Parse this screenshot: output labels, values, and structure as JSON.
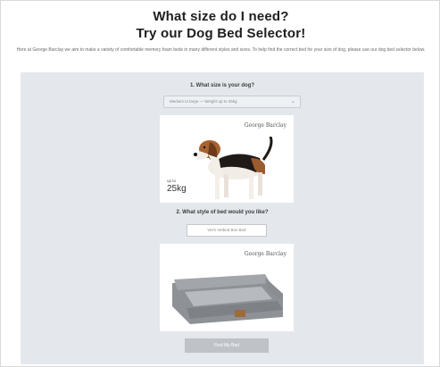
{
  "header": {
    "title_line1": "What size do I need?",
    "title_line2": "Try our Dog Bed Selector!",
    "intro": "Here at George Barclay we aim to make a variety of comfortable memory foam beds in many different styles and sizes. To help find the correct bed for your size of dog, please use our dog bed selector below."
  },
  "selector": {
    "q1": "1. What size is your dog?",
    "size_select": "Medium to large  — Weight up to 25kg",
    "dog_card": {
      "brand": "George Barclay",
      "weight_prefix": "up to",
      "weight": "25kg"
    },
    "q2": "2. What style of bed would you like?",
    "style_select": "Vet's Vetbed Box Bed",
    "bed_card": {
      "brand": "George Barclay"
    },
    "submit_label": "Find My Bed"
  },
  "colors": {
    "panel_bg": "#e4e8ec",
    "button_bg": "#bfc3c8"
  }
}
